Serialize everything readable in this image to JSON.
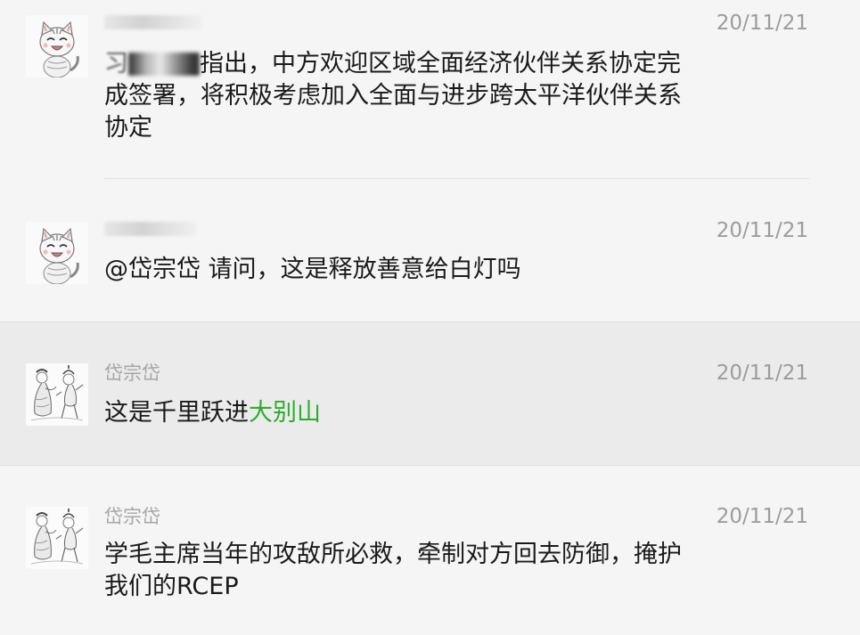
{
  "messages": [
    {
      "name": "",
      "time": "20/11/21",
      "text_redacted_prefix": true,
      "text": "指出，中方欢迎区域全面经济伙伴关系协定完成签署，将积极考虑加入全面与进步跨太平洋伙伴关系协定",
      "text_lead": "习",
      "avatar": "cat-avatar"
    },
    {
      "name": "",
      "time": "20/11/21",
      "text": "@岱宗岱 请问，这是释放善意给白灯吗",
      "avatar": "cat-avatar"
    },
    {
      "name": "岱宗岱",
      "time": "20/11/21",
      "text": "这是千里跃进",
      "text_highlight": "大别山",
      "avatar": "sketch-avatar"
    },
    {
      "name": "岱宗岱",
      "time": "20/11/21",
      "text": "学毛主席当年的攻敌所必救，牵制对方回去防御，掩护我们的RCEP",
      "avatar": "sketch-avatar"
    }
  ],
  "colors": {
    "background": "#f5f5f5",
    "highlight_row": "#ebebeb",
    "link_green": "#2aae2a",
    "name_gray": "#a6a6a6"
  }
}
